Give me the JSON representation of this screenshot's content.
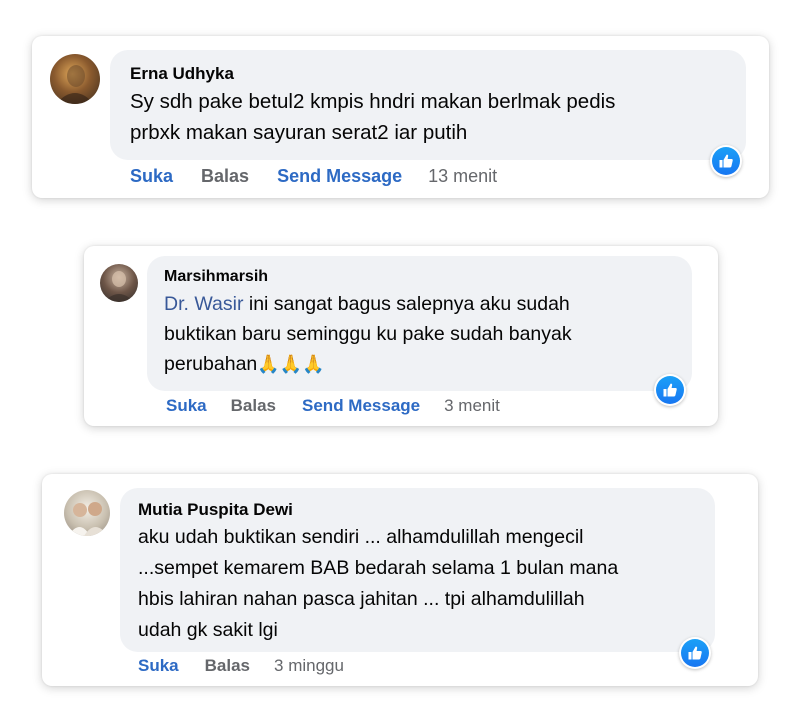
{
  "comments": [
    {
      "author": "Erna Udhyka",
      "text_lines": [
        "Sy sdh pake betul2 kmpis hndri makan berlmak pedis",
        "prbxk makan sayuran serat2 iar putih"
      ],
      "actions": {
        "like": "Suka",
        "reply": "Balas",
        "message": "Send Message",
        "time": "13 menit"
      },
      "avatar_icon": "user-avatar",
      "reaction_icon": "thumbs-up-icon"
    },
    {
      "author": "Marsihmarsih",
      "mention": "Dr. Wasir",
      "text_line1_rest": " ini sangat bagus salepnya aku sudah",
      "text_line2": "buktikan baru seminggu ku pake sudah banyak",
      "text_line3": "perubahan",
      "emoji": "🙏🙏🙏",
      "actions": {
        "like": "Suka",
        "reply": "Balas",
        "message": "Send Message",
        "time": "3 menit"
      },
      "avatar_icon": "user-avatar",
      "reaction_icon": "thumbs-up-icon"
    },
    {
      "author": "Mutia Puspita Dewi",
      "text_lines": [
        "aku udah buktikan sendiri ... alhamdulillah mengecil",
        "...sempet kemarem BAB bedarah selama 1 bulan mana",
        "hbis lahiran nahan pasca jahitan ... tpi alhamdulillah",
        "udah gk sakit lgi"
      ],
      "actions": {
        "like": "Suka",
        "reply": "Balas",
        "time": "3 minggu"
      },
      "avatar_icon": "user-avatar",
      "reaction_icon": "thumbs-up-icon"
    }
  ],
  "colors": {
    "link_blue": "#2d6ac4",
    "mention_blue": "#385898",
    "bubble_bg": "#f0f2f5",
    "meta_gray": "#65676b",
    "like_blue": "#1877f2"
  }
}
